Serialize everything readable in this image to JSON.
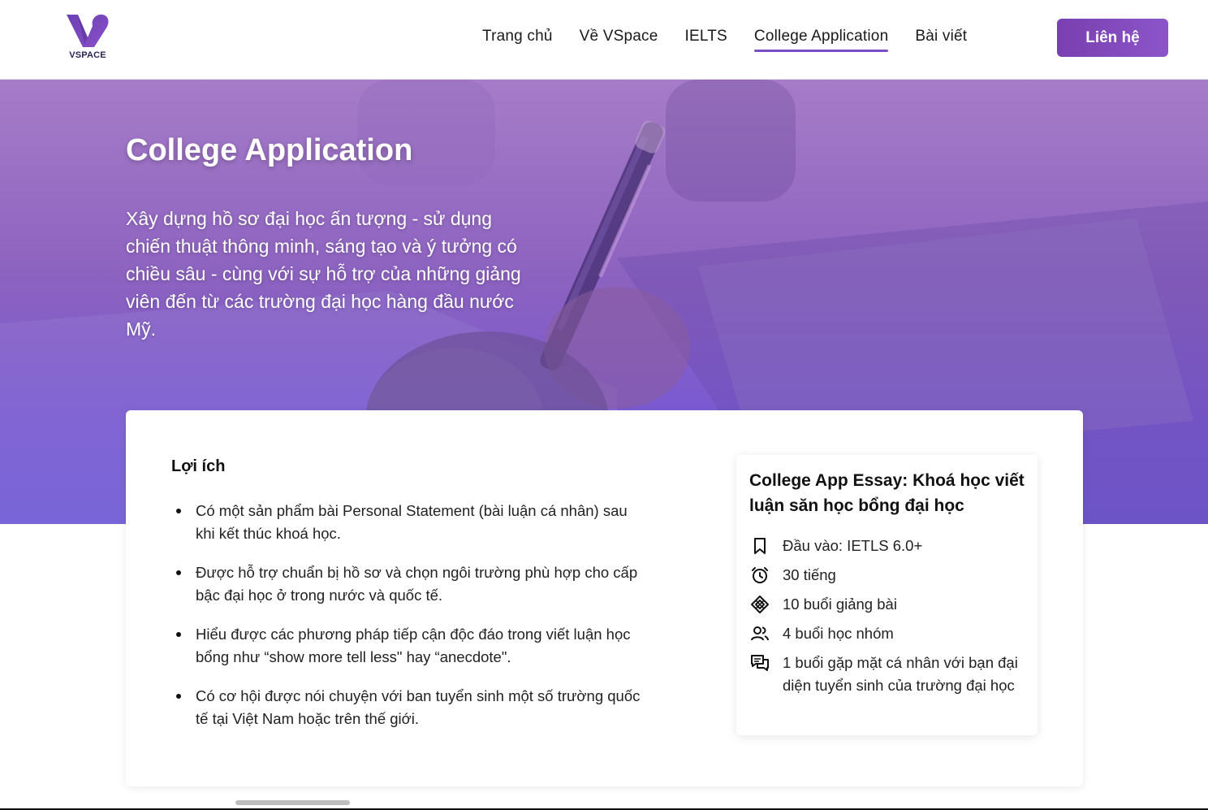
{
  "brand": {
    "logo_text": "VSPACE",
    "accent": "#7a4fc6",
    "logo_color": "#7b3fb8"
  },
  "nav": {
    "items": [
      {
        "label": "Trang chủ"
      },
      {
        "label": "Về VSpace"
      },
      {
        "label": "IELTS"
      },
      {
        "label": "College Application",
        "active": true
      },
      {
        "label": "Bài viết"
      }
    ],
    "contact_label": "Liên hệ"
  },
  "hero": {
    "title": "College Application",
    "description": "Xây dựng hồ sơ đại học ấn tượng - sử dụng chiến thuật thông minh, sáng tạo và ý tưởng có chiều sâu - cùng với sự hỗ trợ của những giảng viên đến từ các trường đại học hàng đầu nước Mỹ."
  },
  "benefits": {
    "title": "Lợi ích",
    "items": [
      "Có một sản phẩm bài Personal Statement (bài luận cá nhân) sau khi kết thúc khoá học.",
      "Được hỗ trợ chuẩn bị hồ sơ và chọn ngôi trường phù hợp cho cấp bậc đại học ở trong nước và quốc tế.",
      "Hiểu được các phương pháp tiếp cận độc đáo trong viết luận học bổng như “show more tell less\" hay “anecdote\".",
      "Có cơ hội được nói chuyện với ban tuyển sinh một số trường quốc tế tại Việt Nam hoặc trên thế giới."
    ]
  },
  "course": {
    "title": "College App Essay: Khoá học viết luận săn học bổng đại học",
    "features": [
      {
        "icon": "bookmark-icon",
        "text": "Đầu vào: IETLS 6.0+"
      },
      {
        "icon": "alarm-clock-icon",
        "text": "30 tiếng"
      },
      {
        "icon": "diamond-grid-icon",
        "text": "10 buổi giảng bài"
      },
      {
        "icon": "group-icon",
        "text": "4 buổi học nhóm"
      },
      {
        "icon": "chat-bubbles-icon",
        "text": "1 buổi gặp mặt cá nhân với bạn đại diện tuyển sinh của trường đại học"
      }
    ]
  }
}
